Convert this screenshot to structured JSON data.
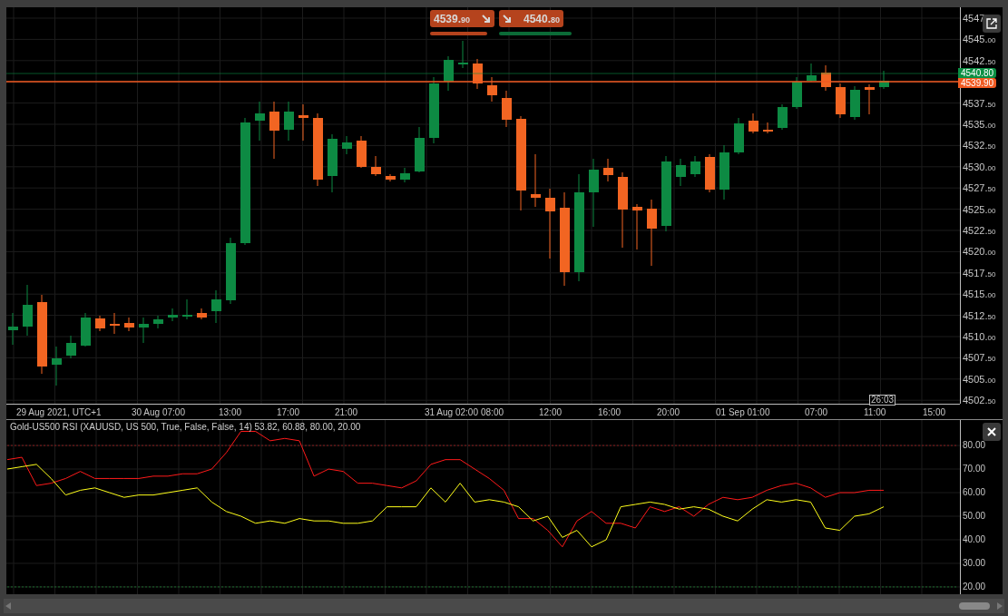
{
  "trade_panel": {
    "sell": {
      "price_main": "4539.",
      "price_fraction": "90"
    },
    "buy": {
      "price_main": "4540.",
      "price_fraction": "80"
    }
  },
  "price_chart": {
    "price_axis_upper": [
      {
        "main": "4547"
      },
      {
        "main": "4545.",
        "fraction": "00"
      },
      {
        "main": "4542.",
        "fraction": "50"
      }
    ],
    "price_axis_lower": [
      {
        "main": "4537.",
        "fraction": "50"
      },
      {
        "main": "4535.",
        "fraction": "00"
      },
      {
        "main": "4532.",
        "fraction": "50"
      },
      {
        "main": "4530.",
        "fraction": "00"
      },
      {
        "main": "4527.",
        "fraction": "50"
      },
      {
        "main": "4525.",
        "fraction": "00"
      },
      {
        "main": "4522.",
        "fraction": "50"
      },
      {
        "main": "4520.",
        "fraction": "00"
      },
      {
        "main": "4517.",
        "fraction": "50"
      },
      {
        "main": "4515.",
        "fraction": "00"
      },
      {
        "main": "4512.",
        "fraction": "50"
      },
      {
        "main": "4510.",
        "fraction": "00"
      },
      {
        "main": "4507.",
        "fraction": "50"
      },
      {
        "main": "4505.",
        "fraction": "00"
      },
      {
        "main": "4502.",
        "fraction": "50"
      }
    ],
    "price_tags": [
      {
        "kind": "ask",
        "label": "4540.80",
        "color": "#0a8f43"
      },
      {
        "kind": "bid",
        "label": "4539.90",
        "color": "#f05a22"
      }
    ],
    "time_axis": [
      "29 Aug 2021, UTC+1",
      "30 Aug 07:00",
      "13:00",
      "17:00",
      "21:00",
      "31 Aug 02:00",
      "08:00",
      "12:00",
      "16:00",
      "20:00",
      "01 Sep 01:00",
      "07:00",
      "11:00",
      "15:00"
    ],
    "countdown": "26:03"
  },
  "rsi_panel": {
    "title": "Gold-US500 RSI (XAUUSD, US 500, True, False, False, 14) 53.82, 60.88, 80.00, 20.00",
    "chart_data": {
      "type": "line",
      "grid": true,
      "ylim": [
        16.9,
        90.8
      ],
      "yticks": [
        {
          "value": 80,
          "label": "80.00"
        },
        {
          "value": 70,
          "label": "70.00"
        },
        {
          "value": 60,
          "label": "60.00"
        },
        {
          "value": 50,
          "label": "50.00"
        },
        {
          "value": 40,
          "label": "40.00"
        },
        {
          "value": 30,
          "label": "30.00"
        },
        {
          "value": 20,
          "label": "20.00"
        }
      ],
      "series": [
        {
          "color": "#ff1a1a",
          "values": [
            74,
            75,
            63,
            64,
            66,
            69,
            66,
            66,
            66,
            66,
            67,
            67,
            68,
            68,
            70,
            77,
            86,
            86,
            82,
            83,
            82,
            67,
            70,
            69,
            64,
            64,
            63,
            62,
            65,
            72,
            74,
            74,
            70,
            66,
            61,
            49,
            49,
            44,
            37,
            48,
            52,
            47,
            47,
            45,
            54,
            52,
            54,
            50,
            55,
            58,
            57,
            58,
            61,
            63,
            64,
            62,
            58,
            60,
            60,
            61,
            61
          ]
        },
        {
          "color": "#ffff1a",
          "values": [
            70,
            71,
            72,
            66,
            59,
            61,
            62,
            60,
            58,
            59,
            59,
            60,
            61,
            62,
            56,
            52,
            50,
            47,
            48,
            47,
            49,
            48,
            48,
            47,
            47,
            48,
            54,
            54,
            54,
            62,
            56,
            64,
            56,
            57,
            56,
            54,
            48,
            50,
            41,
            44,
            37,
            40,
            54,
            55,
            56,
            55,
            53,
            54,
            53,
            50,
            48,
            53,
            57,
            56,
            57,
            56,
            45,
            44,
            50,
            51,
            54
          ]
        },
        {
          "color": "#8a1a1a",
          "line_style": "dashed",
          "values": [
            80,
            80,
            80,
            80,
            80,
            80,
            80,
            80,
            80,
            80,
            80,
            80,
            80,
            80,
            80,
            80,
            80,
            80,
            80,
            80,
            80,
            80,
            80,
            80,
            80,
            80,
            80,
            80,
            80,
            80,
            80,
            80,
            80,
            80,
            80,
            80,
            80,
            80,
            80,
            80,
            80,
            80,
            80,
            80,
            80,
            80,
            80,
            80,
            80,
            80,
            80,
            80,
            80,
            80,
            80,
            80,
            80,
            80,
            80,
            80,
            80,
            80,
            80,
            80,
            80,
            80
          ]
        },
        {
          "color": "#1a6a2a",
          "line_style": "dashed",
          "values": [
            20,
            20,
            20,
            20,
            20,
            20,
            20,
            20,
            20,
            20,
            20,
            20,
            20,
            20,
            20,
            20,
            20,
            20,
            20,
            20,
            20,
            20,
            20,
            20,
            20,
            20,
            20,
            20,
            20,
            20,
            20,
            20,
            20,
            20,
            20,
            20,
            20,
            20,
            20,
            20,
            20,
            20,
            20,
            20,
            20,
            20,
            20,
            20,
            20,
            20,
            20,
            20,
            20,
            20,
            20,
            20,
            20,
            20,
            20,
            20,
            20,
            20,
            20,
            20,
            20,
            20
          ]
        }
      ]
    }
  }
}
